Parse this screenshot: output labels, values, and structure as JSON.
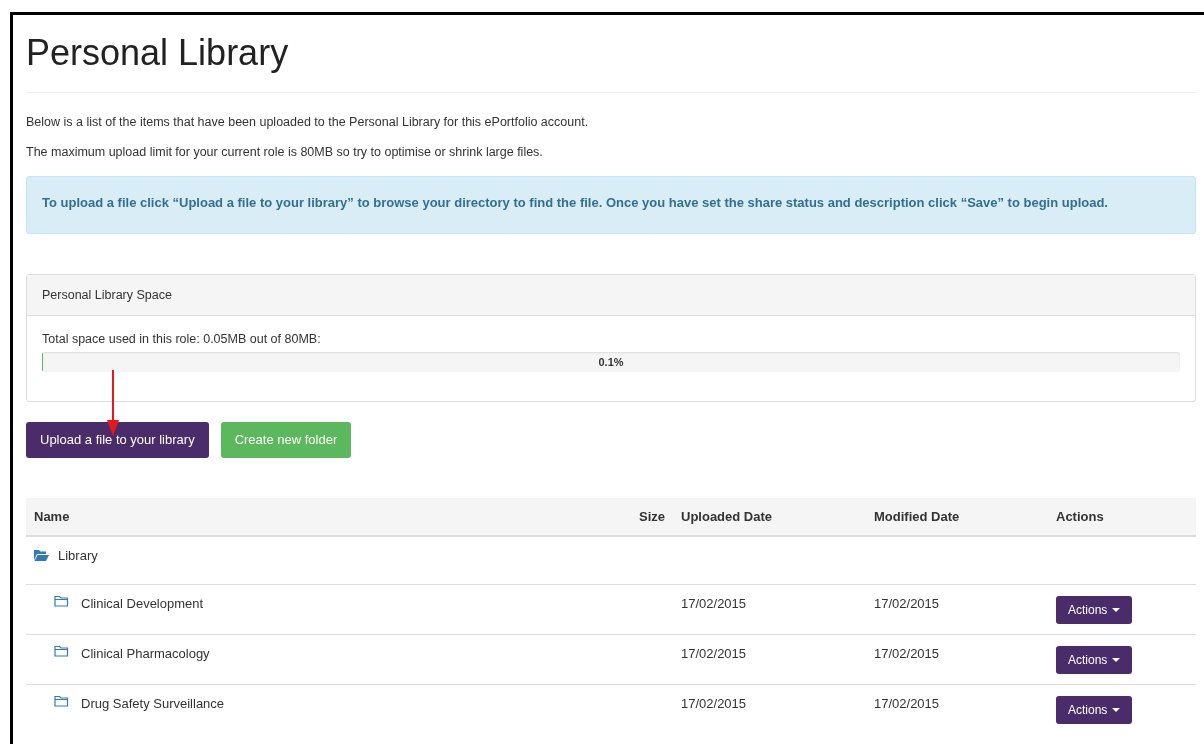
{
  "page": {
    "title": "Personal Library"
  },
  "intro": [
    "Below is a list of the items that have been uploaded to the Personal Library for this ePortfolio account.",
    "The maximum upload limit for your current role is 80MB so try to optimise or shrink large files."
  ],
  "alert": {
    "text": "To upload a file click “Upload a file to your library” to browse your directory to find the file. Once you have set the share status and description click “Save” to begin upload."
  },
  "space_panel": {
    "heading": "Personal Library Space",
    "usage": "Total space used in this role: 0.05MB out of 80MB:",
    "level": 0.001,
    "reading": "0.1%"
  },
  "annotation": {
    "kind": "arrow"
  },
  "buttons": [
    {
      "kind": "primary",
      "label": "Upload a file to your library"
    },
    {
      "kind": "success",
      "label": "Create new folder"
    }
  ],
  "table": {
    "columns": [
      "Name",
      "Size",
      "Uploaded Date",
      "Modified Date",
      "Actions"
    ],
    "rows": [
      {
        "name": "Library",
        "expanded": true,
        "children": [
          {
            "name": "Clinical Development",
            "uploaded": "17/02/2015",
            "modified": "17/02/2015",
            "action": "Actions",
            "expanded": false
          },
          {
            "name": "Clinical Pharmacology",
            "uploaded": "17/02/2015",
            "modified": "17/02/2015",
            "action": "Actions",
            "expanded": false
          },
          {
            "name": "Drug Safety Surveillance",
            "uploaded": "17/02/2015",
            "modified": "17/02/2015",
            "action": "Actions",
            "expanded": false
          }
        ]
      }
    ]
  }
}
